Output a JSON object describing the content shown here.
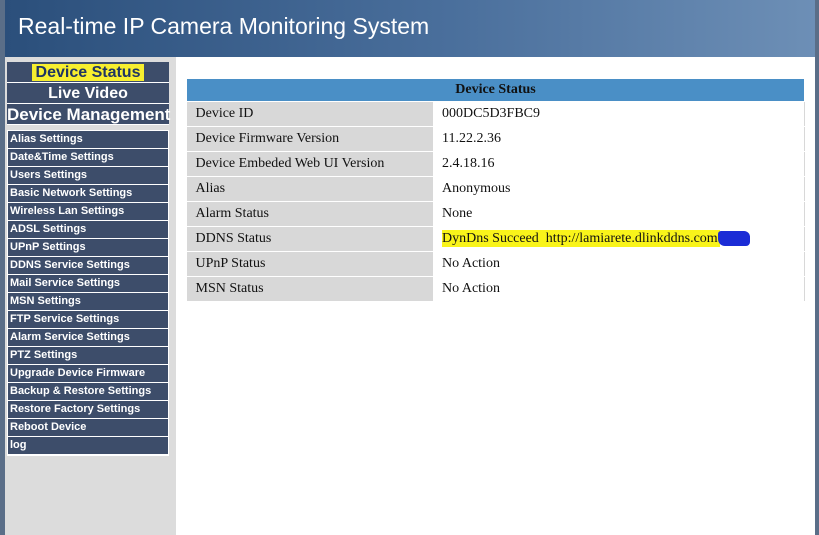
{
  "header": {
    "title": "Real-time IP Camera Monitoring System"
  },
  "main_nav": [
    {
      "label": "Device Status",
      "active": true
    },
    {
      "label": "Live Video"
    },
    {
      "label": "Device Management"
    }
  ],
  "settings_menu": [
    "Alias Settings",
    "Date&Time Settings",
    "Users Settings",
    "Basic Network Settings",
    "Wireless Lan Settings",
    "ADSL Settings",
    "UPnP Settings",
    "DDNS Service Settings",
    "Mail Service Settings",
    "MSN Settings",
    "FTP Service Settings",
    "Alarm Service Settings",
    "PTZ Settings",
    "Upgrade Device Firmware",
    "Backup & Restore Settings",
    "Restore Factory Settings",
    "Reboot Device",
    "log"
  ],
  "status_table": {
    "title": "Device Status",
    "rows": [
      {
        "label": "Device ID",
        "value": "000DC5D3FBC9"
      },
      {
        "label": "Device Firmware Version",
        "value": "11.22.2.36"
      },
      {
        "label": "Device Embeded Web UI Version",
        "value": "2.4.18.16"
      },
      {
        "label": "Alias",
        "value": "Anonymous"
      },
      {
        "label": "Alarm Status",
        "value": "None"
      },
      {
        "label": "DDNS Status",
        "value": "DynDns Succeed  http://lamiarete.dlinkddns.com"
      },
      {
        "label": "UPnP Status",
        "value": "No Action"
      },
      {
        "label": "MSN Status",
        "value": "No Action"
      }
    ]
  },
  "colors": {
    "header_gradient_start": "#2b4f7b",
    "header_gradient_end": "#6d8fb6",
    "nav_background": "#3d4d6a",
    "active_highlight": "#f7ef2f",
    "table_header": "#4a8fc6",
    "label_cell": "#d8d8d8",
    "ddns_highlight": "#f9f41a",
    "redaction_scribble": "#1b2cd6"
  }
}
